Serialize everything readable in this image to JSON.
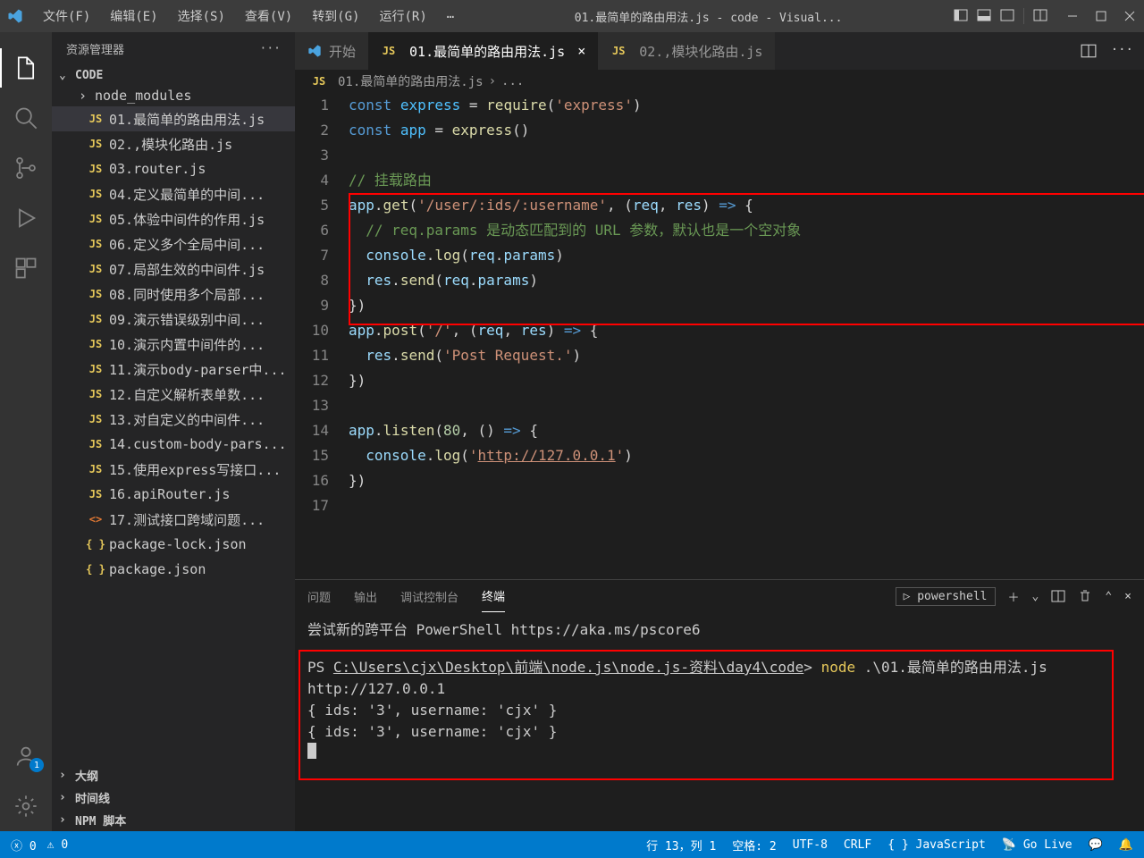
{
  "titlebar": {
    "menu": [
      "文件(F)",
      "编辑(E)",
      "选择(S)",
      "查看(V)",
      "转到(G)",
      "运行(R)",
      "…"
    ],
    "title": "01.最简单的路由用法.js - code - Visual..."
  },
  "sidebar": {
    "header": "资源管理器",
    "root": "CODE",
    "folder": "node_modules",
    "files": [
      "01.最简单的路由用法.js",
      "02.,模块化路由.js",
      "03.router.js",
      "04.定义最简单的中间...",
      "05.体验中间件的作用.js",
      "06.定义多个全局中间...",
      "07.局部生效的中间件.js",
      "08.同时使用多个局部...",
      "09.演示错误级别中间...",
      "10.演示内置中间件的...",
      "11.演示body-parser中...",
      "12.自定义解析表单数...",
      "13.对自定义的中间件...",
      "14.custom-body-pars...",
      "15.使用express写接口...",
      "16.apiRouter.js"
    ],
    "html_file": "17.测试接口跨域问题...",
    "json_files": [
      "package-lock.json",
      "package.json"
    ],
    "outline": "大纲",
    "timeline": "时间线",
    "npm": "NPM 脚本"
  },
  "tabs": {
    "t0": "开始",
    "t1": "01.最简单的路由用法.js",
    "t2": "02.,模块化路由.js"
  },
  "breadcrumb": {
    "file": "01.最简单的路由用法.js",
    "more": "..."
  },
  "code_lines": 17,
  "terminal": {
    "tabs": [
      "问题",
      "输出",
      "调试控制台",
      "终端"
    ],
    "shell": "powershell",
    "intro": "尝试新的跨平台 PowerShell https://aka.ms/pscore6",
    "prompt_ps": "PS ",
    "prompt_path": "C:\\Users\\cjx\\Desktop\\前端\\node.js\\node.js-资料\\day4\\code",
    "prompt_gt": ">",
    "cmd": "node",
    "cmd_arg": ".\\01.最简单的路由用法.js",
    "out1": "http://127.0.0.1",
    "out2": "{ ids: '3', username: 'cjx' }",
    "out3": "{ ids: '3', username: 'cjx' }"
  },
  "statusbar": {
    "errors": "0",
    "warnings": "0",
    "pos": "行 13，列 1",
    "spaces": "空格: 2",
    "encoding": "UTF-8",
    "eol": "CRLF",
    "lang": "JavaScript",
    "golive": "Go Live"
  },
  "account_badge": "1"
}
